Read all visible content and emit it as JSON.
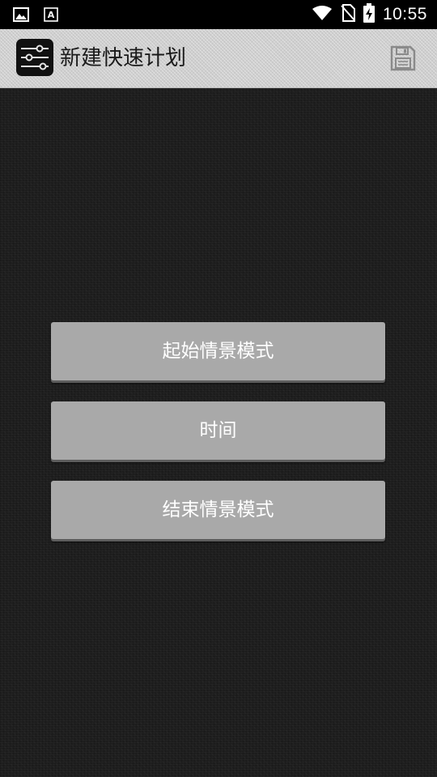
{
  "status_bar": {
    "time": "10:55",
    "icons": [
      "image-icon",
      "text-a-icon",
      "wifi-icon",
      "no-sim-icon",
      "battery-charging-icon"
    ]
  },
  "action_bar": {
    "title": "新建快速计划",
    "app_icon": "sliders-icon",
    "save_icon": "save-icon"
  },
  "buttons": {
    "start_profile": "起始情景模式",
    "time": "时间",
    "end_profile": "结束情景模式"
  },
  "colors": {
    "background": "#1e1e1e",
    "action_bar": "#cfcfcf",
    "button": "#a9a9a9",
    "button_text": "#ffffff"
  }
}
